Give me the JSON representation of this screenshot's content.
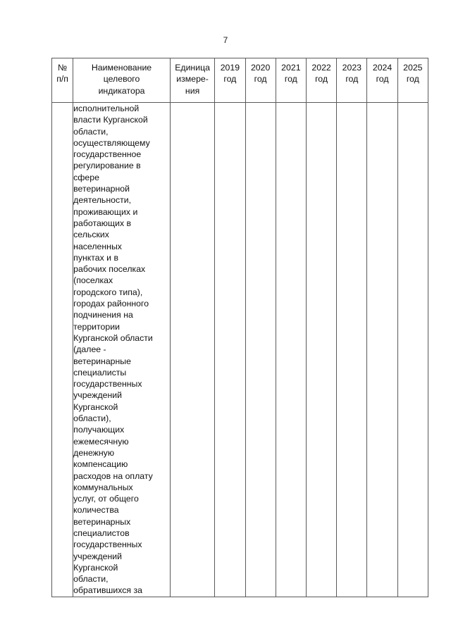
{
  "page": {
    "number": "7"
  },
  "table": {
    "header": {
      "no": "№\nп/п",
      "name": "Наименование\nцелевого\nиндикатора",
      "unit": "Единица\nизмере-\nния",
      "years": [
        "2019\nгод",
        "2020\nгод",
        "2021\nгод",
        "2022\nгод",
        "2023\nгод",
        "2024\nгод",
        "2025\nгод"
      ]
    },
    "rows": [
      {
        "no": "",
        "name": "исполнительной\nвласти Курганской\nобласти,\nосуществляющему\nгосударственное\nрегулирование в\nсфере\nветеринарной\nдеятельности,\nпроживающих и\nработающих в\nсельских\nнаселенных\nпунктах и в\nрабочих поселках\n(поселках\nгородского типа),\nгородах районного\nподчинения на\nтерритории\nКурганской области\n(далее -\nветеринарные\nспециалисты\nгосударственных\nучреждений\nКурганской\nобласти),\nполучающих\nежемесячную\nденежную\nкомпенсацию\nрасходов на оплату\nкоммунальных\nуслуг, от общего\nколичества\nветеринарных\nспециалистов\nгосударственных\nучреждений\nКурганской\nобласти,\nобратившихся за",
        "unit": "",
        "values": [
          "",
          "",
          "",
          "",
          "",
          "",
          ""
        ]
      }
    ]
  }
}
